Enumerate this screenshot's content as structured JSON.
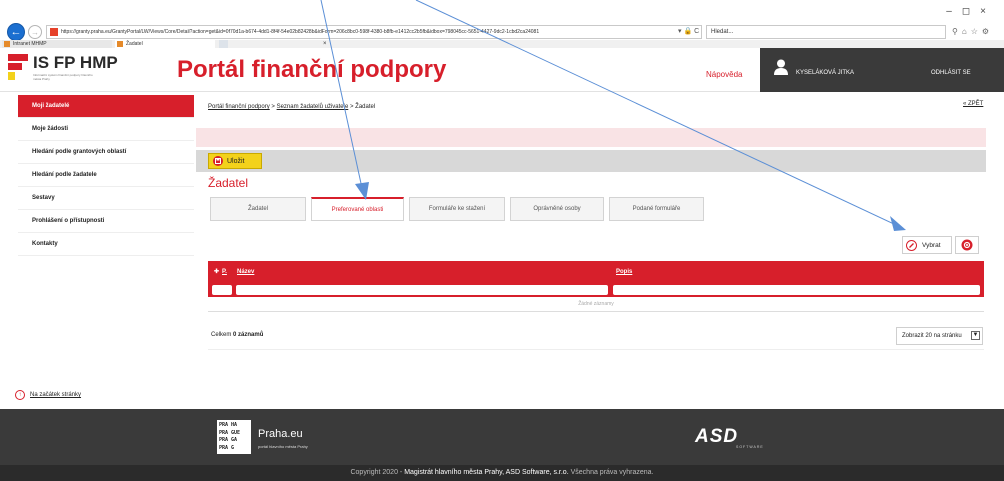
{
  "browser": {
    "url": "https://granty.praha.eu/GrantyPortal/LW/Views/Core/Detail?action=get&id=0f70d1a-b674-4dd1-8f4f-54e02b82428b&idForm=206c8bc0-598f-4380-b8fb-e1412cc2b5fb&idbox=798045cc-5651-4427-9dc2-1cbd2ca24081",
    "address_tools": "▾ 🔒 C",
    "search_placeholder": "Hledat...",
    "tabs": [
      {
        "label": "Intranet MHMP"
      },
      {
        "label": "Žadatel"
      }
    ],
    "tab_close": "×"
  },
  "header": {
    "logo_title": "IS FP HMP",
    "logo_sub": "Informační systém finanční podpory hlavního města Prahy",
    "portal_title": "Portál finanční podpory",
    "help": "Nápověda",
    "user_name": "KYSELÁKOVÁ JITKA",
    "logout": "ODHLÁSIT SE"
  },
  "sidebar": {
    "items": [
      {
        "label": "Moji žadatelé"
      },
      {
        "label": "Moje žádosti"
      },
      {
        "label": "Hledání podle grantových oblastí"
      },
      {
        "label": "Hledání podle žadatele"
      },
      {
        "label": "Sestavy"
      },
      {
        "label": "Prohlášení o přístupnosti"
      },
      {
        "label": "Kontakty"
      }
    ]
  },
  "breadcrumb": {
    "items": [
      "Portál finanční podpory",
      "Seznam žadatelů uživatele",
      "Žadatel"
    ],
    "separator": ">"
  },
  "back_link": "« ZPĚT",
  "toolbar": {
    "save_label": "Uložit"
  },
  "page_title": "Žadatel",
  "tabs": [
    {
      "label": "Žadatel"
    },
    {
      "label": "Preferované oblasti"
    },
    {
      "label": "Formuláře ke stažení"
    },
    {
      "label": "Oprávněné osoby"
    },
    {
      "label": "Podané formuláře"
    }
  ],
  "actions": {
    "select_label": "Vybrat"
  },
  "table": {
    "columns": [
      "P.",
      "Název",
      "Popis"
    ],
    "sort_marker": "✚",
    "empty_text": "Žádné záznamy",
    "total_label": "Celkem",
    "total_count": "0",
    "total_suffix": "záznamů",
    "page_size": "Zobrazit 20 na stránku"
  },
  "top_link": "Na začátek stránky",
  "footer": {
    "praha_logo": [
      "PRA HA",
      "PRA GUE",
      "PRA GA",
      "PRA G"
    ],
    "praha_name": "Praha.eu",
    "praha_sub": "portál hlavního města Prahy",
    "asd_logo": "ASD",
    "asd_sub": "SOFTWARE",
    "copyright_prefix": "Copyright 2020 -",
    "copyright_owner": "Magistrát hlavního města Prahy, ASD Software, s.r.o.",
    "copyright_suffix": "Všechna práva vyhrazena."
  },
  "colors": {
    "accent": "#d71f2b",
    "save_button": "#f3d21b",
    "header_dark": "#3a3a3a",
    "annotation_arrow": "#5b8fd6"
  }
}
